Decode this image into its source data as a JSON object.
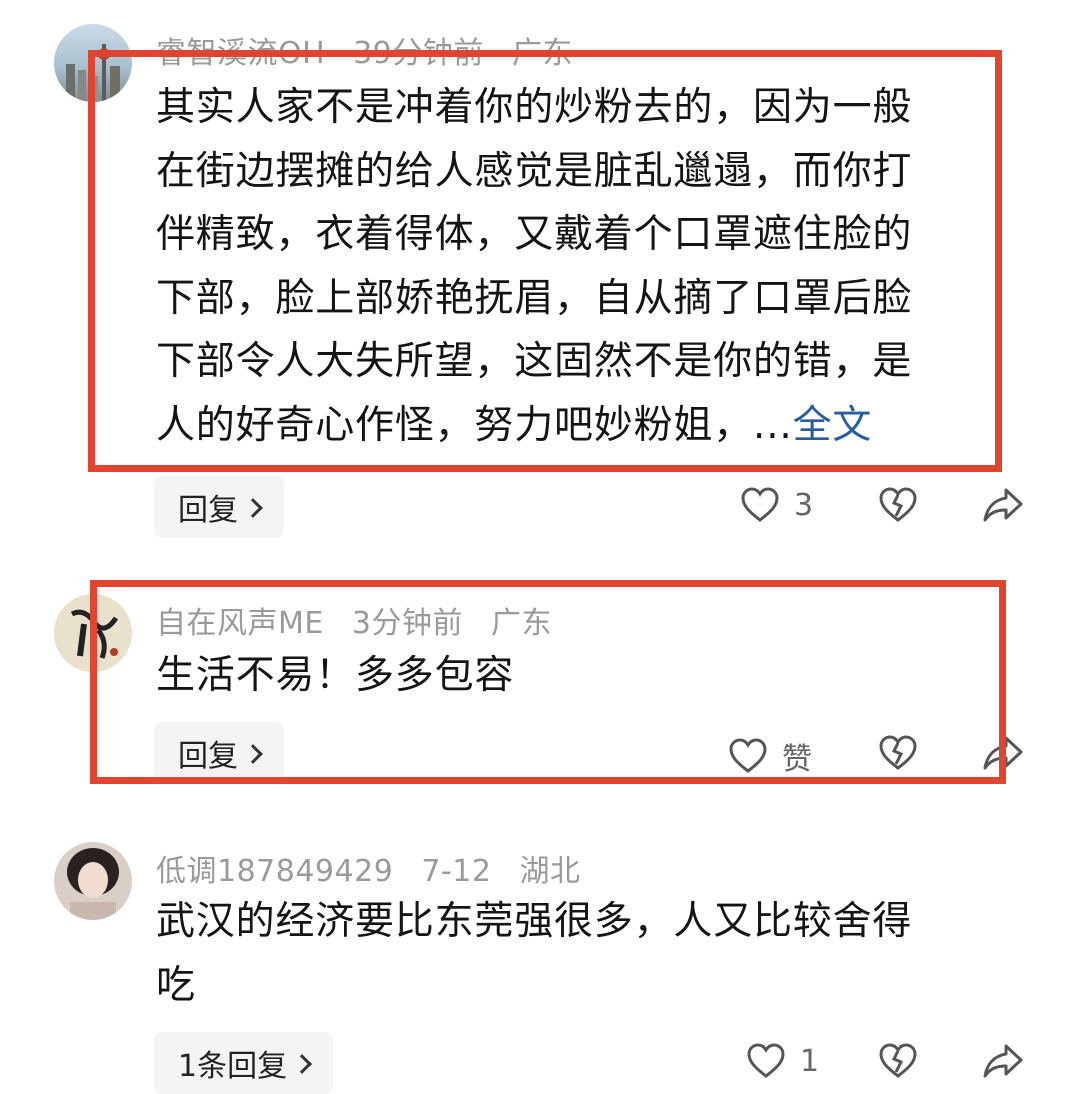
{
  "comments": [
    {
      "username": "睿智溪流OH",
      "time": "39分钟前",
      "location": "广东",
      "lines": [
        "其实人家不是冲着你的炒粉去的，因为一般",
        "在街边摆摊的给人感觉是脏乱邋遢，而你打",
        "伴精致，衣着得体，又戴着个口罩遮住脸的",
        "下部，脸上部娇艳抚眉，自从摘了口罩后脸",
        "下部令人大失所望，这固然不是你的错，是",
        "人的好奇心作怪，努力吧妙粉姐，..."
      ],
      "full_text_link": "全文",
      "reply_label": "回复",
      "like_label": "3"
    },
    {
      "username": "自在风声ME",
      "time": "3分钟前",
      "location": "广东",
      "lines": [
        "生活不易！多多包容"
      ],
      "reply_label": "回复",
      "like_label": "赞"
    },
    {
      "username": "低调187849429",
      "time": "7-12",
      "location": "湖北",
      "lines": [
        "武汉的经济要比东莞强很多，人又比较舍得",
        "吃"
      ],
      "reply_label": "1条回复",
      "like_label": "1"
    }
  ],
  "icons": {
    "like": "heart-outline-icon",
    "dislike": "broken-heart-icon",
    "share": "share-arrow-icon",
    "reply_chevron": "chevron-right-icon"
  },
  "colors": {
    "highlight_box": "#e0452f",
    "link": "#2a5d9f",
    "meta_text": "#9a9a9a"
  }
}
